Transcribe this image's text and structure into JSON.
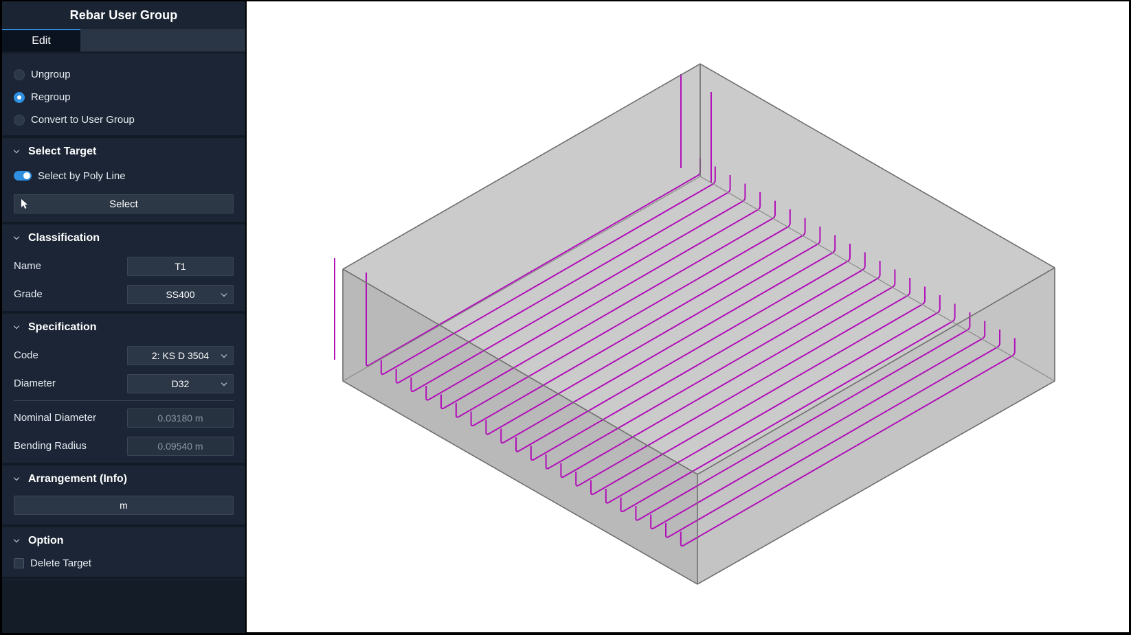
{
  "panel": {
    "title": "Rebar User Group",
    "tabs": [
      {
        "label": "Edit"
      }
    ],
    "mode_options": [
      {
        "label": "Ungroup",
        "selected": false
      },
      {
        "label": "Regroup",
        "selected": true
      },
      {
        "label": "Convert to User Group",
        "selected": false
      }
    ],
    "select_target": {
      "heading": "Select Target",
      "toggle_label": "Select by Poly Line",
      "toggle_on": true,
      "select_button": "Select"
    },
    "classification": {
      "heading": "Classification",
      "name_label": "Name",
      "name_value": "T1",
      "grade_label": "Grade",
      "grade_value": "SS400"
    },
    "specification": {
      "heading": "Specification",
      "code_label": "Code",
      "code_value": "2: KS D 3504",
      "diameter_label": "Diameter",
      "diameter_value": "D32",
      "nominal_diameter_label": "Nominal Diameter",
      "nominal_diameter_value": "0.03180 m",
      "bending_radius_label": "Bending Radius",
      "bending_radius_value": "0.09540 m"
    },
    "arrangement": {
      "heading": "Arrangement (Info)",
      "value": "m"
    },
    "option": {
      "heading": "Option",
      "delete_target_label": "Delete Target",
      "delete_target_checked": false
    }
  },
  "colors": {
    "accent": "#2f8fe0",
    "rebar": "#b10fb8",
    "box_fill": "#c2c2c2",
    "confirm": "#2ec24a",
    "add": "#2f9bf0",
    "cancel": "#e23a3a"
  }
}
